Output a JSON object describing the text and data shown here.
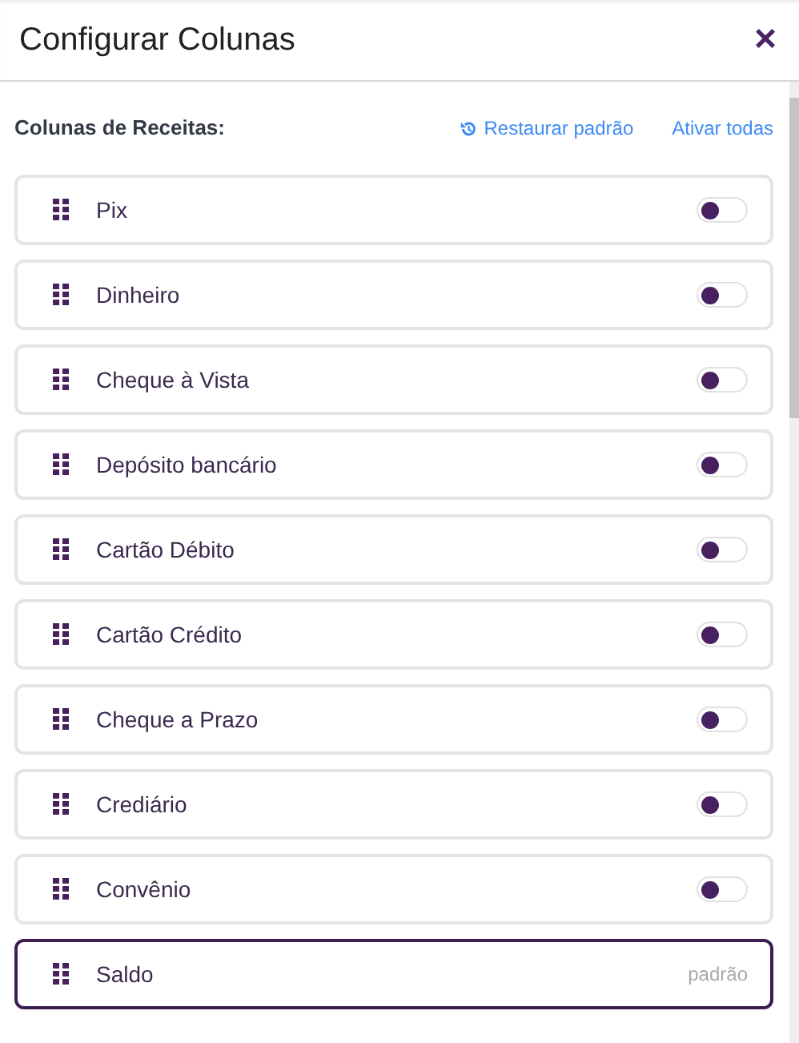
{
  "header": {
    "title": "Configurar Colunas",
    "close": "×"
  },
  "section": {
    "label": "Colunas de Receitas:",
    "restore": "Restaurar padrão",
    "activate_all": "Ativar todas"
  },
  "columns": [
    {
      "kind": "toggle",
      "name": "Pix",
      "on": false
    },
    {
      "kind": "toggle",
      "name": "Dinheiro",
      "on": false
    },
    {
      "kind": "toggle",
      "name": "Cheque à Vista",
      "on": false
    },
    {
      "kind": "toggle",
      "name": "Depósito bancário",
      "on": false
    },
    {
      "kind": "toggle",
      "name": "Cartão Débito",
      "on": false
    },
    {
      "kind": "toggle",
      "name": "Cartão Crédito",
      "on": false
    },
    {
      "kind": "toggle",
      "name": "Cheque a Prazo",
      "on": false
    },
    {
      "kind": "toggle",
      "name": "Crediário",
      "on": false
    },
    {
      "kind": "toggle",
      "name": "Convênio",
      "on": false
    },
    {
      "kind": "fixed",
      "name": "Saldo",
      "tag": "padrão"
    }
  ]
}
